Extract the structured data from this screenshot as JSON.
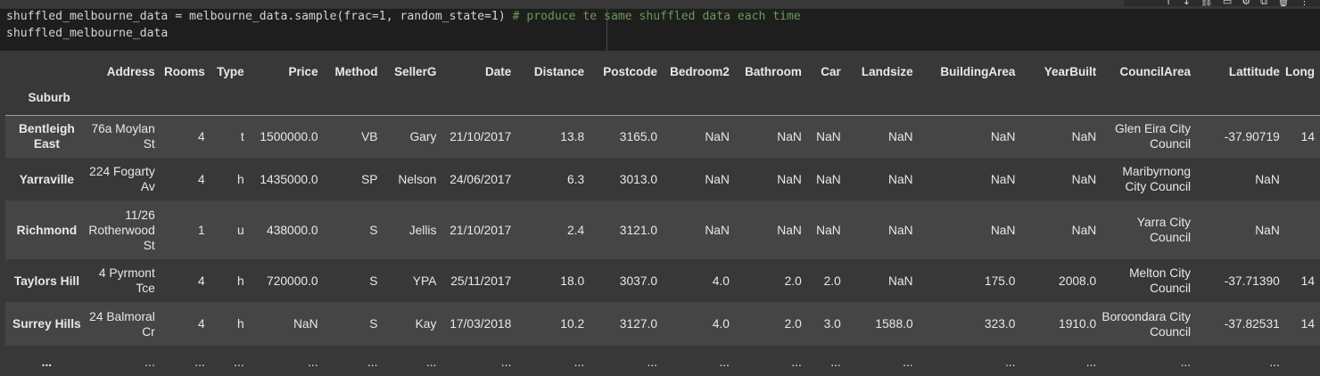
{
  "toolbar": {
    "icons": [
      "arrow-up-icon",
      "arrow-down-icon",
      "link-icon",
      "comment-icon",
      "gear-icon",
      "mirror-icon",
      "delete-icon",
      "more-icon"
    ],
    "glyphs": [
      "↑",
      "↓",
      "⛓",
      "▭",
      "⚙",
      "⧉",
      "🗑",
      "⋮"
    ]
  },
  "code": {
    "line1_code": "shuffled_melbourne_data = melbourne_data.sample(frac=1, random_state=1) ",
    "line1_comment": "# produce te same shuffled data each time",
    "line2": "shuffled_melbourne_data"
  },
  "table": {
    "index_name": "Suburb",
    "columns": [
      "Address",
      "Rooms",
      "Type",
      "Price",
      "Method",
      "SellerG",
      "Date",
      "Distance",
      "Postcode",
      "Bedroom2",
      "Bathroom",
      "Car",
      "Landsize",
      "BuildingArea",
      "YearBuilt",
      "CouncilArea",
      "Lattitude",
      "Long"
    ],
    "rows": [
      {
        "index": "Bentleigh East",
        "cells": [
          "76a Moylan St",
          "4",
          "t",
          "1500000.0",
          "VB",
          "Gary",
          "21/10/2017",
          "13.8",
          "3165.0",
          "NaN",
          "NaN",
          "NaN",
          "NaN",
          "NaN",
          "NaN",
          "Glen Eira City Council",
          "-37.90719",
          "14"
        ]
      },
      {
        "index": "Yarraville",
        "cells": [
          "224 Fogarty Av",
          "4",
          "h",
          "1435000.0",
          "SP",
          "Nelson",
          "24/06/2017",
          "6.3",
          "3013.0",
          "NaN",
          "NaN",
          "NaN",
          "NaN",
          "NaN",
          "NaN",
          "Maribyrnong City Council",
          "NaN",
          ""
        ]
      },
      {
        "index": "Richmond",
        "cells": [
          "11/26 Rotherwood St",
          "1",
          "u",
          "438000.0",
          "S",
          "Jellis",
          "21/10/2017",
          "2.4",
          "3121.0",
          "NaN",
          "NaN",
          "NaN",
          "NaN",
          "NaN",
          "NaN",
          "Yarra City Council",
          "NaN",
          ""
        ]
      },
      {
        "index": "Taylors Hill",
        "cells": [
          "4 Pyrmont Tce",
          "4",
          "h",
          "720000.0",
          "S",
          "YPA",
          "25/11/2017",
          "18.0",
          "3037.0",
          "4.0",
          "2.0",
          "2.0",
          "NaN",
          "175.0",
          "2008.0",
          "Melton City Council",
          "-37.71390",
          "14"
        ]
      },
      {
        "index": "Surrey Hills",
        "cells": [
          "24 Balmoral Cr",
          "4",
          "h",
          "NaN",
          "S",
          "Kay",
          "17/03/2018",
          "10.2",
          "3127.0",
          "4.0",
          "2.0",
          "3.0",
          "1588.0",
          "323.0",
          "1910.0",
          "Boroondara City Council",
          "-37.82531",
          "14"
        ]
      },
      {
        "index": "...",
        "cells": [
          "...",
          "...",
          "...",
          "...",
          "...",
          "...",
          "...",
          "...",
          "...",
          "...",
          "...",
          "...",
          "...",
          "...",
          "...",
          "...",
          "...",
          ""
        ]
      }
    ]
  }
}
